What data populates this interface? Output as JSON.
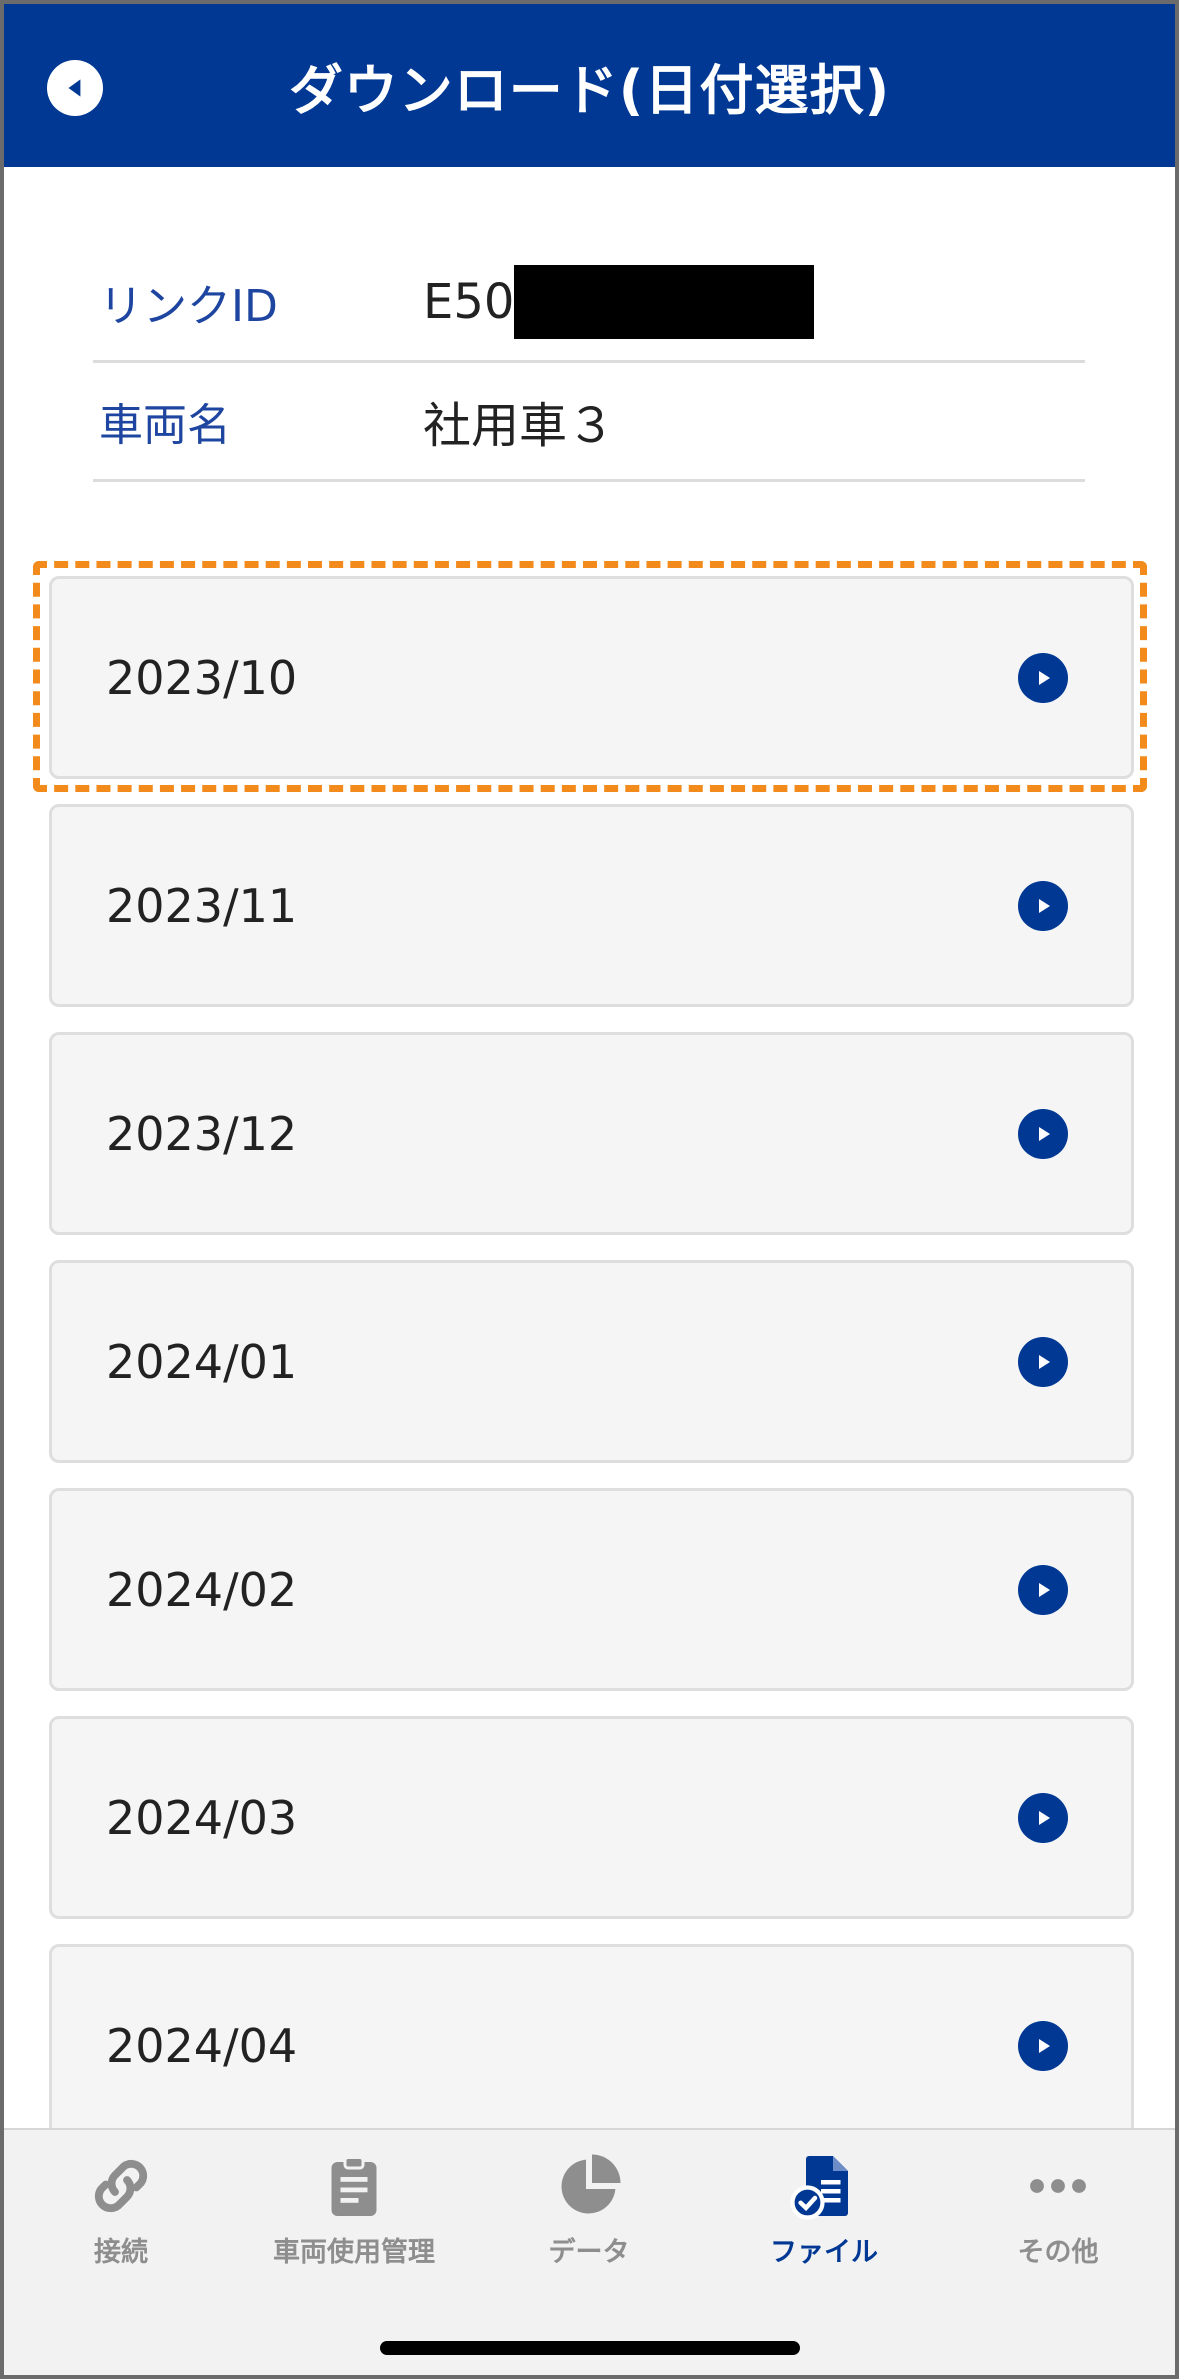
{
  "header": {
    "title": "ダウンロード(日付選択)",
    "back_icon": "back-arrow-circle-icon"
  },
  "info": {
    "link_id_label": "リンクID",
    "link_id_value": "E50",
    "vehicle_label": "車両名",
    "vehicle_value": "社用車３"
  },
  "months": [
    {
      "label": "2023/10"
    },
    {
      "label": "2023/11"
    },
    {
      "label": "2023/12"
    },
    {
      "label": "2024/01"
    },
    {
      "label": "2024/02"
    },
    {
      "label": "2024/03"
    },
    {
      "label": "2024/04"
    }
  ],
  "tabs": [
    {
      "label": "接続",
      "icon": "link-icon"
    },
    {
      "label": "車両使用管理",
      "icon": "clipboard-icon"
    },
    {
      "label": "データ",
      "icon": "pie-chart-icon"
    },
    {
      "label": "ファイル",
      "icon": "file-check-icon"
    },
    {
      "label": "その他",
      "icon": "more-icon"
    }
  ],
  "colors": {
    "brand": "#003894",
    "highlight": "#f28a1c",
    "inactive_tab": "#8e8e8e"
  }
}
